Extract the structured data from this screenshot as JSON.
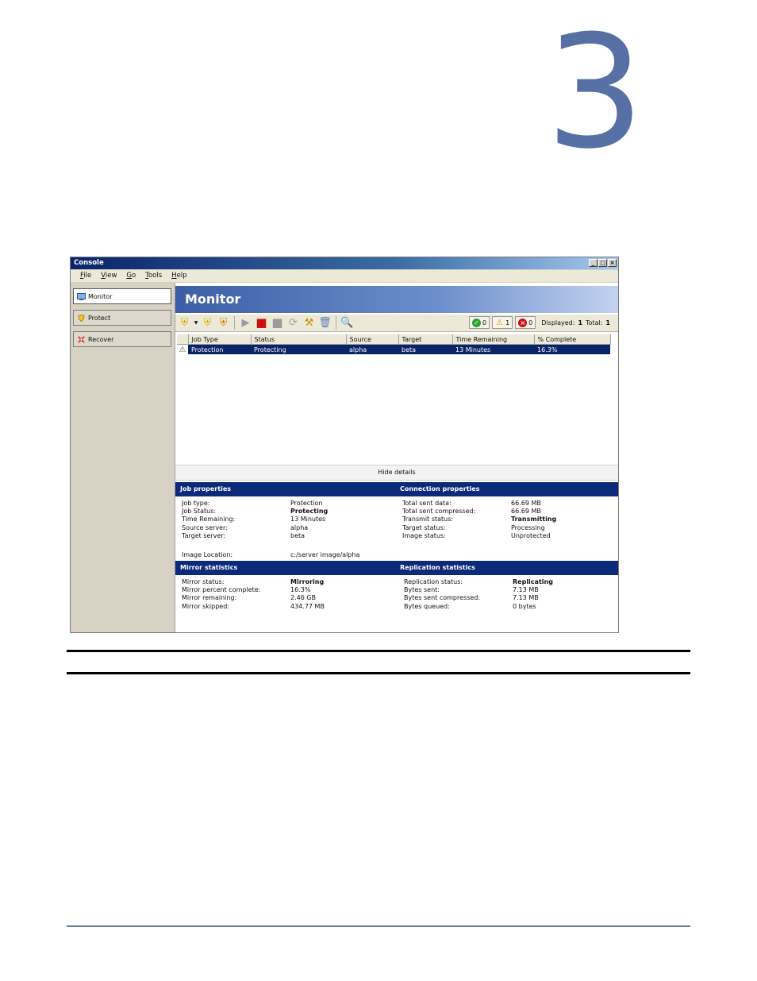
{
  "chapter": {
    "number": "3"
  },
  "colors": {
    "chapter_number": "#5670a6",
    "selection": "#0a246a",
    "section_header": "#0b2a7a"
  },
  "window": {
    "title": "Console",
    "controls": {
      "minimize": "_",
      "maximize": "□",
      "close": "×"
    },
    "menu": [
      "File",
      "View",
      "Go",
      "Tools",
      "Help"
    ]
  },
  "sidebar": {
    "items": [
      {
        "label": "Monitor",
        "icon": "monitor-icon",
        "active": true
      },
      {
        "label": "Protect",
        "icon": "shield-icon",
        "active": false
      },
      {
        "label": "Recover",
        "icon": "recover-icon",
        "active": false
      }
    ]
  },
  "main": {
    "title": "Monitor",
    "toolbar": {
      "ok_count": "0",
      "warning_count": "1",
      "error_count": "0",
      "displayed_label": "Displayed:",
      "displayed_value": "1",
      "total_label": "Total:",
      "total_value": "1"
    },
    "jobs": {
      "columns": [
        "Job Type",
        "Status",
        "Source",
        "Target",
        "Time Remaining",
        "% Complete"
      ],
      "rows": [
        {
          "job_type": "Protection",
          "status": "Protecting",
          "source": "alpha",
          "target": "beta",
          "time_remaining": "13 Minutes",
          "percent_complete": "16.3%"
        }
      ]
    },
    "hide_details": "Hide details"
  },
  "details": {
    "job_properties": {
      "title": "Job properties",
      "job_type_label": "Job type:",
      "job_type": "Protection",
      "job_status_label": "Job Status:",
      "job_status": "Protecting",
      "time_remaining_label": "Time Remaining:",
      "time_remaining": "13 Minutes",
      "source_server_label": "Source server:",
      "source_server": "alpha",
      "target_server_label": "Target server:",
      "target_server": "beta",
      "image_location_label": "Image Location:",
      "image_location": "c:/server image/alpha"
    },
    "connection_properties": {
      "title": "Connection properties",
      "total_sent_label": "Total sent data:",
      "total_sent": "66.69 MB",
      "total_sent_compressed_label": "Total sent compressed:",
      "total_sent_compressed": "66.69 MB",
      "transmit_status_label": "Transmit status:",
      "transmit_status": "Transmitting",
      "target_status_label": "Target status:",
      "target_status": "Processing",
      "image_status_label": "Image status:",
      "image_status": "Unprotected"
    },
    "mirror_statistics": {
      "title": "Mirror statistics",
      "status_label": "Mirror status:",
      "status": "Mirroring",
      "percent_label": "Mirror percent complete:",
      "percent": "16.3%",
      "remaining_label": "Mirror remaining:",
      "remaining": "2.46 GB",
      "skipped_label": "Mirror skipped:",
      "skipped": "434.77 MB"
    },
    "replication_statistics": {
      "title": "Replication statistics",
      "status_label": "Replication status:",
      "status": "Replicating",
      "bytes_sent_label": "Bytes sent:",
      "bytes_sent": "7.13 MB",
      "bytes_sent_compressed_label": "Bytes sent compressed:",
      "bytes_sent_compressed": "7.13 MB",
      "bytes_queued_label": "Bytes queued:",
      "bytes_queued": "0 bytes"
    }
  }
}
